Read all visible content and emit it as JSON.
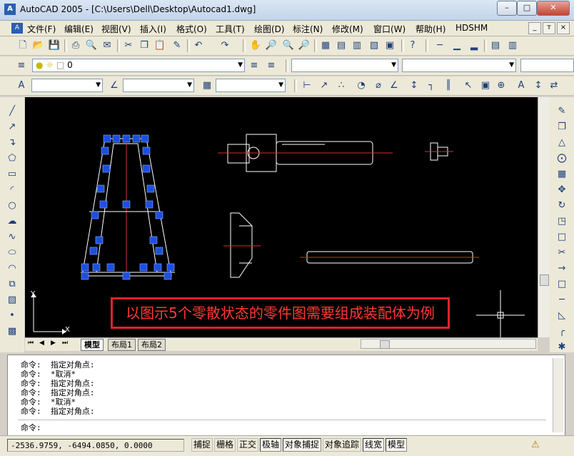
{
  "window": {
    "title": "AutoCAD 2005 - [C:\\Users\\Dell\\Desktop\\Autocad1.dwg]",
    "app_icon_label": "A",
    "minimize": "–",
    "maximize": "□",
    "close": "✕"
  },
  "menu": {
    "items": [
      "文件(F)",
      "编辑(E)",
      "视图(V)",
      "插入(I)",
      "格式(O)",
      "工具(T)",
      "绘图(D)",
      "标注(N)",
      "修改(M)",
      "窗口(W)",
      "帮助(H)",
      "HDSHM"
    ],
    "doc_min": "_",
    "doc_restore": "т",
    "doc_close": "×"
  },
  "layer": {
    "current": "0"
  },
  "command_window": {
    "lines": [
      "命令:  指定对角点:",
      "命令:  *取消*",
      "命令:  指定对角点:",
      "命令:  指定对角点:",
      "命令:  *取消*",
      "命令:  指定对角点:"
    ],
    "prompt": "命令:"
  },
  "layout_tabs": [
    "模型",
    "布局1",
    "布局2"
  ],
  "status": {
    "coordinates": "-2536.9759, -6494.0850, 0.0000",
    "buttons": [
      {
        "label": "捕捉",
        "on": false
      },
      {
        "label": "栅格",
        "on": false
      },
      {
        "label": "正交",
        "on": false
      },
      {
        "label": "极轴",
        "on": true
      },
      {
        "label": "对象捕捉",
        "on": true
      },
      {
        "label": "对象追踪",
        "on": false
      },
      {
        "label": "线宽",
        "on": true
      },
      {
        "label": "模型",
        "on": true
      }
    ]
  },
  "ucs": {
    "x_label": "X",
    "y_label": "Y"
  },
  "annotation": {
    "text": "以图示5个零散状态的零件图需要组成装配体为例",
    "color": "#e0232b"
  },
  "colors": {
    "canvas": "#000000",
    "grip": "#1d4fe0",
    "centerline": "#e12a2a"
  }
}
